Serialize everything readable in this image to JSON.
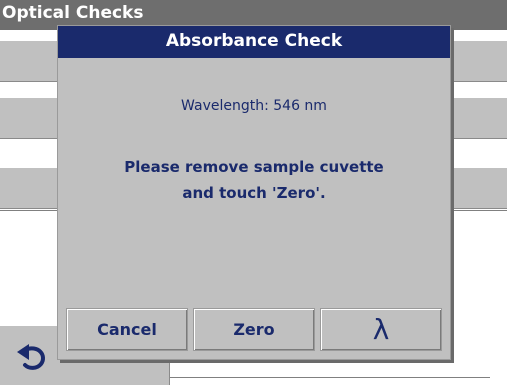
{
  "screen": {
    "title": "Optical Checks"
  },
  "dialog": {
    "title": "Absorbance Check",
    "wavelength_text": "Wavelength: 546 nm",
    "instruction_line1": "Please remove sample cuvette",
    "instruction_line2": "and touch 'Zero'."
  },
  "buttons": {
    "cancel_label": "Cancel",
    "zero_label": "Zero",
    "lambda_label": "λ"
  },
  "icons": {
    "back": "back-arrow-icon"
  },
  "colors": {
    "title_bar": "#6e6e6e",
    "dialog_title_bar": "#1a2a6c",
    "panel": "#c0c0c0",
    "text": "#1a2a6c"
  }
}
